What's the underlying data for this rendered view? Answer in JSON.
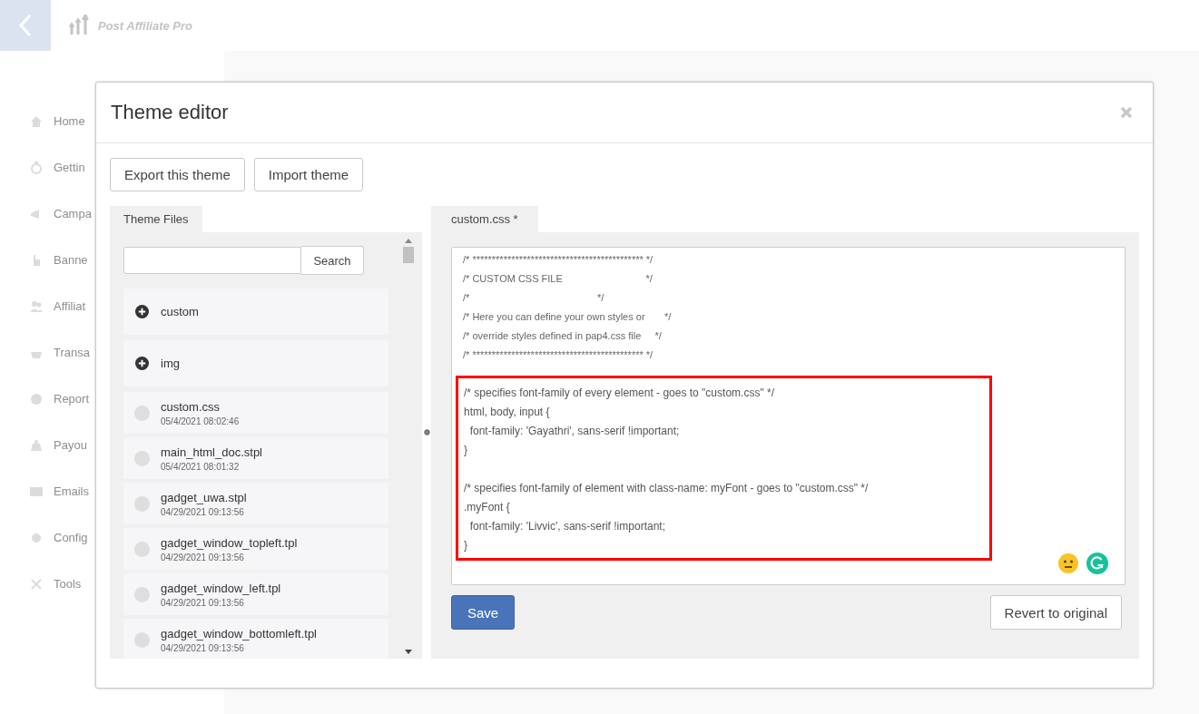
{
  "app": {
    "name": "Post Affiliate Pro"
  },
  "sidebar": {
    "items": [
      {
        "label": "Home"
      },
      {
        "label": "Gettin"
      },
      {
        "label": "Campa"
      },
      {
        "label": "Banne"
      },
      {
        "label": "Affiliat"
      },
      {
        "label": "Transa"
      },
      {
        "label": "Report"
      },
      {
        "label": "Payou"
      },
      {
        "label": "Emails"
      },
      {
        "label": "Config"
      },
      {
        "label": "Tools"
      }
    ]
  },
  "dialog": {
    "title": "Theme editor",
    "toolbar_buttons": [
      "Export this theme",
      "Import theme"
    ],
    "files_panel": {
      "tab": "Theme Files",
      "search": {
        "button": "Search"
      },
      "items": [
        {
          "kind": "folder",
          "name": "custom"
        },
        {
          "kind": "folder",
          "name": "img"
        },
        {
          "kind": "file",
          "name": "custom.css",
          "date": "05/4/2021 08:02:46"
        },
        {
          "kind": "file",
          "name": "main_html_doc.stpl",
          "date": "05/4/2021 08:01:32"
        },
        {
          "kind": "file",
          "name": "gadget_uwa.stpl",
          "date": "04/29/2021 09:13:56"
        },
        {
          "kind": "file",
          "name": "gadget_window_topleft.tpl",
          "date": "04/29/2021 09:13:56"
        },
        {
          "kind": "file",
          "name": "gadget_window_left.tpl",
          "date": "04/29/2021 09:13:56"
        },
        {
          "kind": "file",
          "name": "gadget_window_bottomleft.tpl",
          "date": "04/29/2021 09:13:56"
        }
      ]
    },
    "editor": {
      "tab": "custom.css *",
      "lines": [
        "/* ******************************************** */",
        "/* CUSTOM CSS FILE                              */",
        "/*                                              */",
        "/* Here you can define your own styles or       */",
        "/* override styles defined in pap4.css file     */",
        "/* ******************************************** */"
      ],
      "highlight_blocks": [
        {
          "lines": [
            "/* specifies font-family of every element - goes to \"custom.css\" */",
            "html, body, input {",
            "  font-family: 'Gayathri', sans-serif !important;",
            "}"
          ]
        },
        {
          "lines": [
            "/* specifies font-family of element with class-name: myFont - goes to \"custom.css\" */",
            ".myFont {",
            "  font-family: 'Livvic', sans-serif !important;",
            "}"
          ]
        }
      ]
    },
    "save_button": "Save",
    "revert_button": "Revert to original"
  }
}
